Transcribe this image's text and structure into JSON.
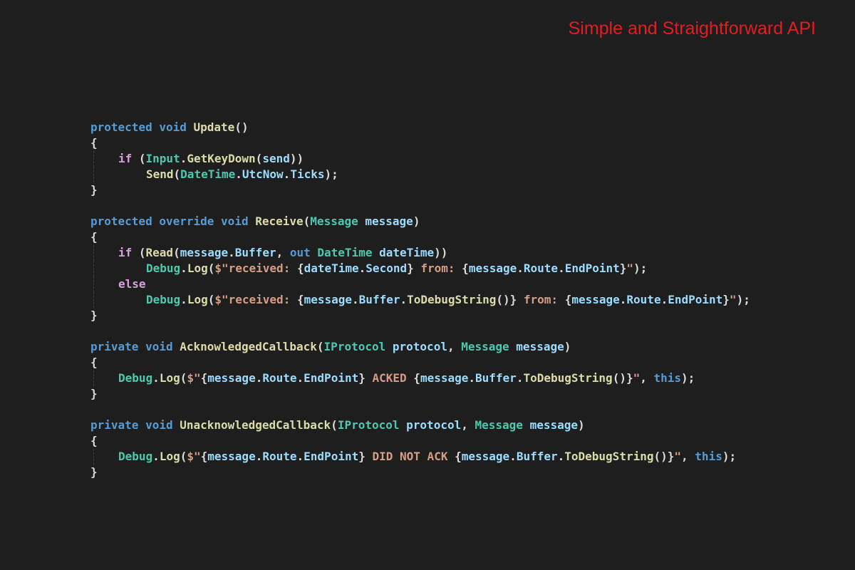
{
  "title": "Simple and Straightforward API",
  "colors": {
    "title": "#e51c23",
    "background": "#1e1e1e",
    "keyword": "#569cd6",
    "control": "#d8a0df",
    "type": "#4ec9b0",
    "method": "#dcdcaa",
    "variable": "#9cdcfe",
    "string": "#d69d85",
    "plain": "#dcdcdc"
  },
  "code": [
    {
      "indent": 0,
      "guide": false,
      "tokens": [
        [
          "kw",
          "protected"
        ],
        [
          "pn",
          " "
        ],
        [
          "kw",
          "void"
        ],
        [
          "pn",
          " "
        ],
        [
          "fn",
          "Update"
        ],
        [
          "pn",
          "()"
        ]
      ]
    },
    {
      "indent": 0,
      "guide": false,
      "tokens": [
        [
          "pn",
          "{"
        ]
      ]
    },
    {
      "indent": 1,
      "guide": true,
      "tokens": [
        [
          "ctl",
          "if"
        ],
        [
          "pn",
          " ("
        ],
        [
          "ty",
          "Input"
        ],
        [
          "pn",
          "."
        ],
        [
          "fn",
          "GetKeyDown"
        ],
        [
          "pn",
          "("
        ],
        [
          "vr",
          "send"
        ],
        [
          "pn",
          "))"
        ]
      ]
    },
    {
      "indent": 2,
      "guide": true,
      "tokens": [
        [
          "fn",
          "Send"
        ],
        [
          "pn",
          "("
        ],
        [
          "ty",
          "DateTime"
        ],
        [
          "pn",
          "."
        ],
        [
          "vr",
          "UtcNow"
        ],
        [
          "pn",
          "."
        ],
        [
          "vr",
          "Ticks"
        ],
        [
          "pn",
          ");"
        ]
      ]
    },
    {
      "indent": 0,
      "guide": false,
      "tokens": [
        [
          "pn",
          "}"
        ]
      ]
    },
    {
      "blank": true
    },
    {
      "indent": 0,
      "guide": false,
      "tokens": [
        [
          "kw",
          "protected"
        ],
        [
          "pn",
          " "
        ],
        [
          "kw",
          "override"
        ],
        [
          "pn",
          " "
        ],
        [
          "kw",
          "void"
        ],
        [
          "pn",
          " "
        ],
        [
          "fn",
          "Receive"
        ],
        [
          "pn",
          "("
        ],
        [
          "ty",
          "Message"
        ],
        [
          "pn",
          " "
        ],
        [
          "vr",
          "message"
        ],
        [
          "pn",
          ")"
        ]
      ]
    },
    {
      "indent": 0,
      "guide": false,
      "tokens": [
        [
          "pn",
          "{"
        ]
      ]
    },
    {
      "indent": 1,
      "guide": true,
      "tokens": [
        [
          "ctl",
          "if"
        ],
        [
          "pn",
          " ("
        ],
        [
          "fn",
          "Read"
        ],
        [
          "pn",
          "("
        ],
        [
          "vr",
          "message"
        ],
        [
          "pn",
          "."
        ],
        [
          "vr",
          "Buffer"
        ],
        [
          "pn",
          ", "
        ],
        [
          "kw",
          "out"
        ],
        [
          "pn",
          " "
        ],
        [
          "ty",
          "DateTime"
        ],
        [
          "pn",
          " "
        ],
        [
          "vr",
          "dateTime"
        ],
        [
          "pn",
          "))"
        ]
      ]
    },
    {
      "indent": 2,
      "guide": true,
      "tokens": [
        [
          "ty",
          "Debug"
        ],
        [
          "pn",
          "."
        ],
        [
          "fn",
          "Log"
        ],
        [
          "pn",
          "("
        ],
        [
          "st",
          "$\"received: "
        ],
        [
          "pn",
          "{"
        ],
        [
          "vr",
          "dateTime"
        ],
        [
          "pn",
          "."
        ],
        [
          "vr",
          "Second"
        ],
        [
          "pn",
          "}"
        ],
        [
          "st",
          " from: "
        ],
        [
          "pn",
          "{"
        ],
        [
          "vr",
          "message"
        ],
        [
          "pn",
          "."
        ],
        [
          "vr",
          "Route"
        ],
        [
          "pn",
          "."
        ],
        [
          "vr",
          "EndPoint"
        ],
        [
          "pn",
          "}"
        ],
        [
          "st",
          "\""
        ],
        [
          "pn",
          ");"
        ]
      ]
    },
    {
      "indent": 1,
      "guide": true,
      "tokens": [
        [
          "ctl",
          "else"
        ]
      ]
    },
    {
      "indent": 2,
      "guide": true,
      "tokens": [
        [
          "ty",
          "Debug"
        ],
        [
          "pn",
          "."
        ],
        [
          "fn",
          "Log"
        ],
        [
          "pn",
          "("
        ],
        [
          "st",
          "$\"received: "
        ],
        [
          "pn",
          "{"
        ],
        [
          "vr",
          "message"
        ],
        [
          "pn",
          "."
        ],
        [
          "vr",
          "Buffer"
        ],
        [
          "pn",
          "."
        ],
        [
          "fn",
          "ToDebugString"
        ],
        [
          "pn",
          "()}"
        ],
        [
          "st",
          " from: "
        ],
        [
          "pn",
          "{"
        ],
        [
          "vr",
          "message"
        ],
        [
          "pn",
          "."
        ],
        [
          "vr",
          "Route"
        ],
        [
          "pn",
          "."
        ],
        [
          "vr",
          "EndPoint"
        ],
        [
          "pn",
          "}"
        ],
        [
          "st",
          "\""
        ],
        [
          "pn",
          ");"
        ]
      ]
    },
    {
      "indent": 0,
      "guide": false,
      "tokens": [
        [
          "pn",
          "}"
        ]
      ]
    },
    {
      "blank": true
    },
    {
      "indent": 0,
      "guide": false,
      "tokens": [
        [
          "kw",
          "private"
        ],
        [
          "pn",
          " "
        ],
        [
          "kw",
          "void"
        ],
        [
          "pn",
          " "
        ],
        [
          "fn",
          "AcknowledgedCallback"
        ],
        [
          "pn",
          "("
        ],
        [
          "ty",
          "IProtocol"
        ],
        [
          "pn",
          " "
        ],
        [
          "vr",
          "protocol"
        ],
        [
          "pn",
          ", "
        ],
        [
          "ty",
          "Message"
        ],
        [
          "pn",
          " "
        ],
        [
          "vr",
          "message"
        ],
        [
          "pn",
          ")"
        ]
      ]
    },
    {
      "indent": 0,
      "guide": false,
      "tokens": [
        [
          "pn",
          "{"
        ]
      ]
    },
    {
      "indent": 1,
      "guide": true,
      "tokens": [
        [
          "ty",
          "Debug"
        ],
        [
          "pn",
          "."
        ],
        [
          "fn",
          "Log"
        ],
        [
          "pn",
          "("
        ],
        [
          "st",
          "$\""
        ],
        [
          "pn",
          "{"
        ],
        [
          "vr",
          "message"
        ],
        [
          "pn",
          "."
        ],
        [
          "vr",
          "Route"
        ],
        [
          "pn",
          "."
        ],
        [
          "vr",
          "EndPoint"
        ],
        [
          "pn",
          "}"
        ],
        [
          "st",
          " ACKED "
        ],
        [
          "pn",
          "{"
        ],
        [
          "vr",
          "message"
        ],
        [
          "pn",
          "."
        ],
        [
          "vr",
          "Buffer"
        ],
        [
          "pn",
          "."
        ],
        [
          "fn",
          "ToDebugString"
        ],
        [
          "pn",
          "()}"
        ],
        [
          "st",
          "\""
        ],
        [
          "pn",
          ", "
        ],
        [
          "kw",
          "this"
        ],
        [
          "pn",
          ");"
        ]
      ]
    },
    {
      "indent": 0,
      "guide": false,
      "tokens": [
        [
          "pn",
          "}"
        ]
      ]
    },
    {
      "blank": true
    },
    {
      "indent": 0,
      "guide": false,
      "tokens": [
        [
          "kw",
          "private"
        ],
        [
          "pn",
          " "
        ],
        [
          "kw",
          "void"
        ],
        [
          "pn",
          " "
        ],
        [
          "fn",
          "UnacknowledgedCallback"
        ],
        [
          "pn",
          "("
        ],
        [
          "ty",
          "IProtocol"
        ],
        [
          "pn",
          " "
        ],
        [
          "vr",
          "protocol"
        ],
        [
          "pn",
          ", "
        ],
        [
          "ty",
          "Message"
        ],
        [
          "pn",
          " "
        ],
        [
          "vr",
          "message"
        ],
        [
          "pn",
          ")"
        ]
      ]
    },
    {
      "indent": 0,
      "guide": false,
      "tokens": [
        [
          "pn",
          "{"
        ]
      ]
    },
    {
      "indent": 1,
      "guide": true,
      "tokens": [
        [
          "ty",
          "Debug"
        ],
        [
          "pn",
          "."
        ],
        [
          "fn",
          "Log"
        ],
        [
          "pn",
          "("
        ],
        [
          "st",
          "$\""
        ],
        [
          "pn",
          "{"
        ],
        [
          "vr",
          "message"
        ],
        [
          "pn",
          "."
        ],
        [
          "vr",
          "Route"
        ],
        [
          "pn",
          "."
        ],
        [
          "vr",
          "EndPoint"
        ],
        [
          "pn",
          "}"
        ],
        [
          "st",
          " DID NOT ACK "
        ],
        [
          "pn",
          "{"
        ],
        [
          "vr",
          "message"
        ],
        [
          "pn",
          "."
        ],
        [
          "vr",
          "Buffer"
        ],
        [
          "pn",
          "."
        ],
        [
          "fn",
          "ToDebugString"
        ],
        [
          "pn",
          "()}"
        ],
        [
          "st",
          "\""
        ],
        [
          "pn",
          ", "
        ],
        [
          "kw",
          "this"
        ],
        [
          "pn",
          ");"
        ]
      ]
    },
    {
      "indent": 0,
      "guide": false,
      "tokens": [
        [
          "pn",
          "}"
        ]
      ]
    }
  ]
}
